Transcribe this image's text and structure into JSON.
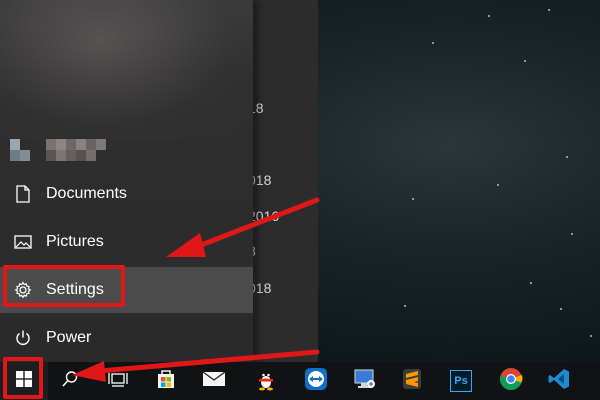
{
  "background_window": {
    "fragments": [
      "18",
      "018",
      "2016",
      "8",
      "018"
    ]
  },
  "start_menu": {
    "items": [
      {
        "label": "Documents",
        "icon": "document-icon"
      },
      {
        "label": "Pictures",
        "icon": "picture-icon"
      },
      {
        "label": "Settings",
        "icon": "gear-icon",
        "highlighted": true
      },
      {
        "label": "Power",
        "icon": "power-icon"
      }
    ]
  },
  "taskbar": {
    "buttons": [
      {
        "name": "start",
        "icon": "windows-logo-icon"
      },
      {
        "name": "search",
        "icon": "search-icon"
      },
      {
        "name": "task-view",
        "icon": "task-view-icon"
      },
      {
        "name": "store",
        "icon": "store-icon"
      },
      {
        "name": "mail",
        "icon": "mail-icon"
      },
      {
        "name": "qq",
        "icon": "penguin-icon"
      },
      {
        "name": "teamviewer",
        "icon": "teamviewer-icon"
      },
      {
        "name": "remote-desktop",
        "icon": "remote-desktop-icon"
      },
      {
        "name": "sublime",
        "icon": "sublime-icon"
      },
      {
        "name": "photoshop",
        "icon": "photoshop-icon",
        "text": "Ps"
      },
      {
        "name": "chrome",
        "icon": "chrome-icon"
      },
      {
        "name": "vscode",
        "icon": "vscode-icon"
      }
    ]
  },
  "colors": {
    "annotation": "#e01717",
    "menu_bg": "#2c2c2c",
    "taskbar_bg": "#101213",
    "highlight": "#4b4b4b"
  }
}
